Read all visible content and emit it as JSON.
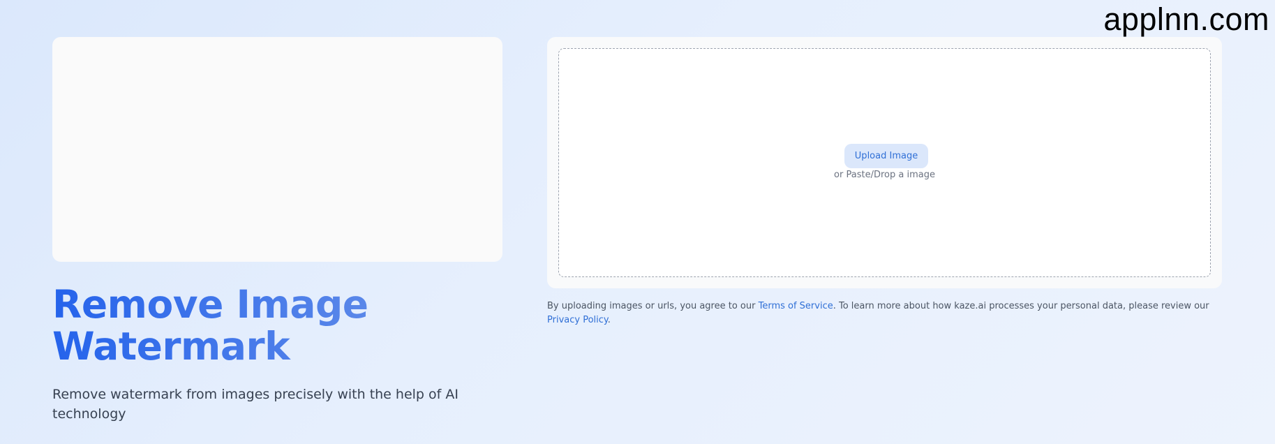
{
  "brand_watermark": "applnn.com",
  "hero": {
    "title": "Remove Image Watermark",
    "subtitle": "Remove watermark from images precisely with the help of AI technology"
  },
  "upload": {
    "button_label": "Upload Image",
    "hint": "or Paste/Drop a image"
  },
  "legal": {
    "prefix": "By uploading images or urls, you agree to our ",
    "terms_link": "Terms of Service",
    "middle": ". To learn more about how kaze.ai processes your personal data, please review our ",
    "privacy_link": "Privacy Policy",
    "suffix": "."
  },
  "colors": {
    "accent": "#2f6fd6",
    "title_gradient_start": "#2563eb",
    "title_gradient_end": "#6b93e8",
    "upload_button_bg": "#dbe7fb"
  }
}
